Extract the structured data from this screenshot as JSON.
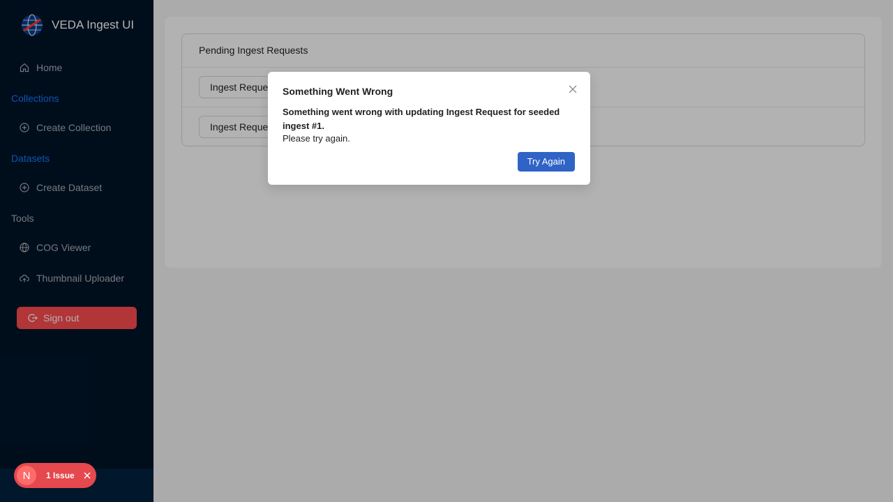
{
  "app": {
    "title": "VEDA Ingest UI"
  },
  "sidebar": {
    "home": "Home",
    "groups": {
      "collections": "Collections",
      "datasets": "Datasets",
      "tools": "Tools"
    },
    "items": {
      "create_collection": "Create Collection",
      "create_dataset": "Create Dataset",
      "cog_viewer": "COG Viewer",
      "thumbnail_uploader": "Thumbnail Uploader"
    },
    "signout": "Sign out"
  },
  "main": {
    "panel_title": "Pending Ingest Requests",
    "requests": [
      {
        "label": "Ingest Request for seeded ingest #1"
      },
      {
        "label": "Ingest Request for seeded ingest #2"
      }
    ]
  },
  "modal": {
    "title": "Something Went Wrong",
    "message": "Something went wrong with updating Ingest Request for seeded ingest #1.",
    "sub": "Please try again.",
    "button": "Try Again"
  },
  "issue_badge": {
    "logo": "N",
    "label": "1 Issue"
  },
  "colors": {
    "sidebar_bg": "#001529",
    "accent": "#1677ff",
    "signout": "#ff4d4f",
    "primary_button": "#2f63c6",
    "issue": "#e5484d"
  },
  "icons": [
    "globe-logo-icon",
    "home-icon",
    "plus-circle-icon",
    "globe-icon",
    "cloud-upload-icon",
    "logout-icon",
    "close-icon"
  ]
}
